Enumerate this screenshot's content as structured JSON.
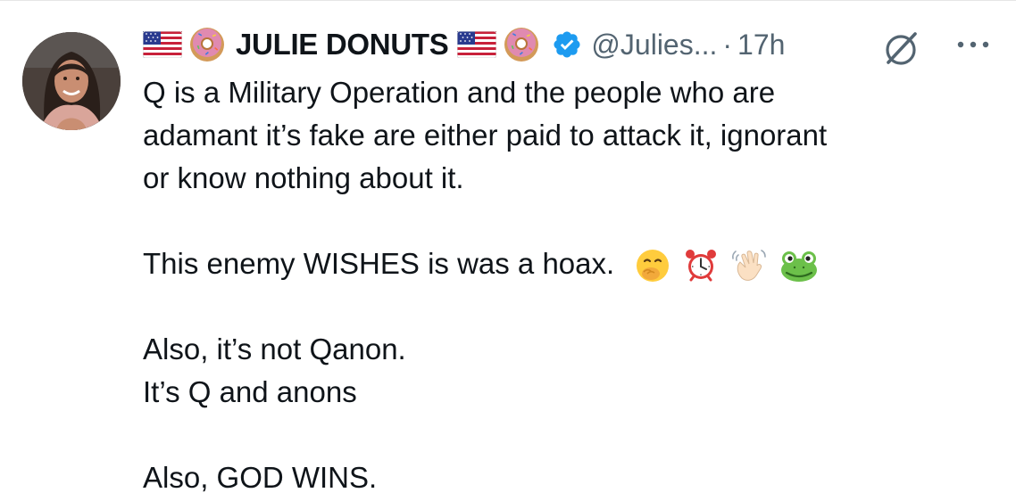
{
  "tweet": {
    "author": {
      "display_name": "JULIE DONUTS",
      "handle": "@Julies...",
      "separator": "·",
      "time": "17h",
      "name_emojis": [
        "us-flag-icon",
        "donut-icon"
      ],
      "verified_color": "#1d9bf0"
    },
    "body": {
      "paragraph_1": [
        "Q is a Military Operation and the people who are",
        "adamant it’s fake are either paid to attack it, ignorant",
        "or know nothing about it."
      ],
      "paragraph_2": "This enemy WISHES is was a hoax.",
      "paragraph_2_emojis": [
        "hand-over-mouth-emoji",
        "alarm-clock-emoji",
        "waving-hand-emoji",
        "frog-emoji"
      ],
      "paragraph_3": [
        "Also, it’s not Qanon.",
        "It’s Q and anons"
      ],
      "paragraph_4": "Also, GOD WINS."
    },
    "icons": [
      "grok-icon",
      "more-icon"
    ]
  }
}
